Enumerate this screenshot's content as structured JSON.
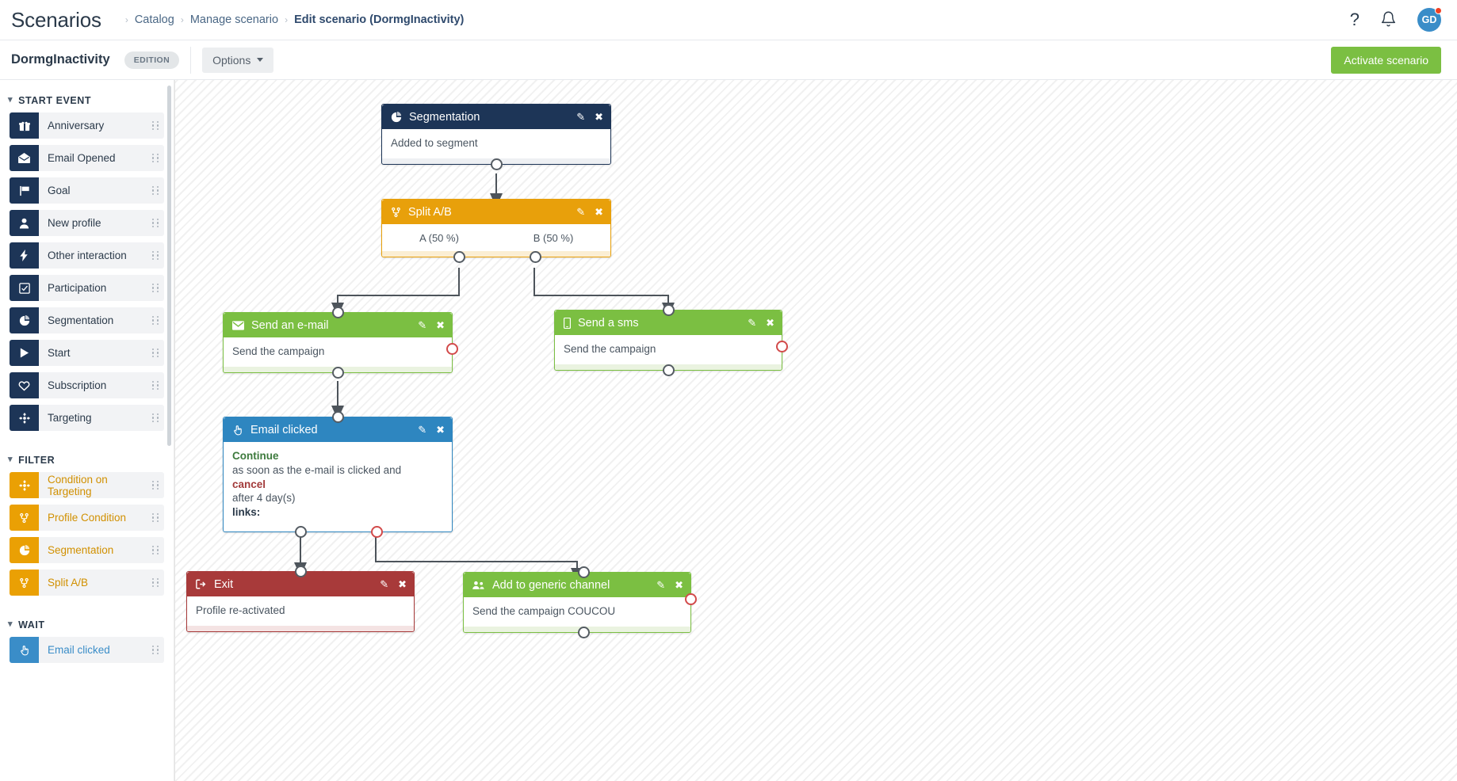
{
  "header": {
    "app_title": "Scenarios",
    "breadcrumb": [
      {
        "label": "Catalog",
        "active": false
      },
      {
        "label": "Manage scenario",
        "active": false
      },
      {
        "label": "Edit scenario (DormgInactivity)",
        "active": true
      }
    ],
    "help_icon": "?",
    "bell_icon": "notification-bell",
    "avatar_initials": "GD"
  },
  "subheader": {
    "scenario_name": "DormgInactivity",
    "edition_badge": "EDITION",
    "options_label": "Options",
    "activate_label": "Activate scenario"
  },
  "sidebar": {
    "sections": [
      {
        "title": "START EVENT",
        "variant": "v-dark",
        "items": [
          {
            "label": "Anniversary",
            "icon": "gift-icon"
          },
          {
            "label": "Email Opened",
            "icon": "envelope-open-icon"
          },
          {
            "label": "Goal",
            "icon": "flag-icon"
          },
          {
            "label": "New profile",
            "icon": "user-icon"
          },
          {
            "label": "Other interaction",
            "icon": "bolt-icon"
          },
          {
            "label": "Participation",
            "icon": "check-square-icon"
          },
          {
            "label": "Segmentation",
            "icon": "pie-chart-icon"
          },
          {
            "label": "Start",
            "icon": "play-icon"
          },
          {
            "label": "Subscription",
            "icon": "heart-icon"
          },
          {
            "label": "Targeting",
            "icon": "crosshair-icon"
          }
        ]
      },
      {
        "title": "FILTER",
        "variant": "v-orange",
        "items": [
          {
            "label": "Condition on Targeting",
            "icon": "crosshair-icon"
          },
          {
            "label": "Profile Condition",
            "icon": "branch-icon"
          },
          {
            "label": "Segmentation",
            "icon": "pie-chart-icon"
          },
          {
            "label": "Split A/B",
            "icon": "branch-icon"
          }
        ]
      },
      {
        "title": "WAIT",
        "variant": "v-blue",
        "items": [
          {
            "label": "Email clicked",
            "icon": "hand-pointer-icon"
          }
        ]
      }
    ]
  },
  "canvas": {
    "edit_icon": "pencil-icon",
    "close_icon": "close-icon",
    "nodes": [
      {
        "id": "segmentation",
        "title": "Segmentation",
        "icon": "pie-chart-icon",
        "theme": "t-dark",
        "body": "Added to segment"
      },
      {
        "id": "split-ab",
        "title": "Split A/B",
        "icon": "branch-icon",
        "theme": "t-orange",
        "branch_a": "A (50 %)",
        "branch_b": "B (50 %)"
      },
      {
        "id": "send-email",
        "title": "Send an e-mail",
        "icon": "envelope-icon",
        "theme": "t-green",
        "body": "Send the campaign"
      },
      {
        "id": "send-sms",
        "title": "Send a sms",
        "icon": "mobile-icon",
        "theme": "t-green",
        "body": "Send the campaign"
      },
      {
        "id": "email-clicked",
        "title": "Email clicked",
        "icon": "hand-pointer-icon",
        "theme": "t-blue",
        "body_continue": "Continue",
        "body_line1": "as soon as the e-mail is clicked and",
        "body_cancel": "cancel",
        "body_line2": "after 4 day(s)",
        "body_links": "links:"
      },
      {
        "id": "exit",
        "title": "Exit",
        "icon": "exit-icon",
        "theme": "t-red",
        "body": "Profile re-activated"
      },
      {
        "id": "add-generic-channel",
        "title": "Add to generic channel",
        "icon": "users-icon",
        "theme": "t-green",
        "body": "Send the campaign COUCOU"
      }
    ]
  },
  "colors": {
    "dark": "#1d3557",
    "orange": "#e8a00b",
    "green": "#7bbf42",
    "blue": "#2e86c0",
    "red": "#a83a3a",
    "accent_link": "#4a6785"
  }
}
